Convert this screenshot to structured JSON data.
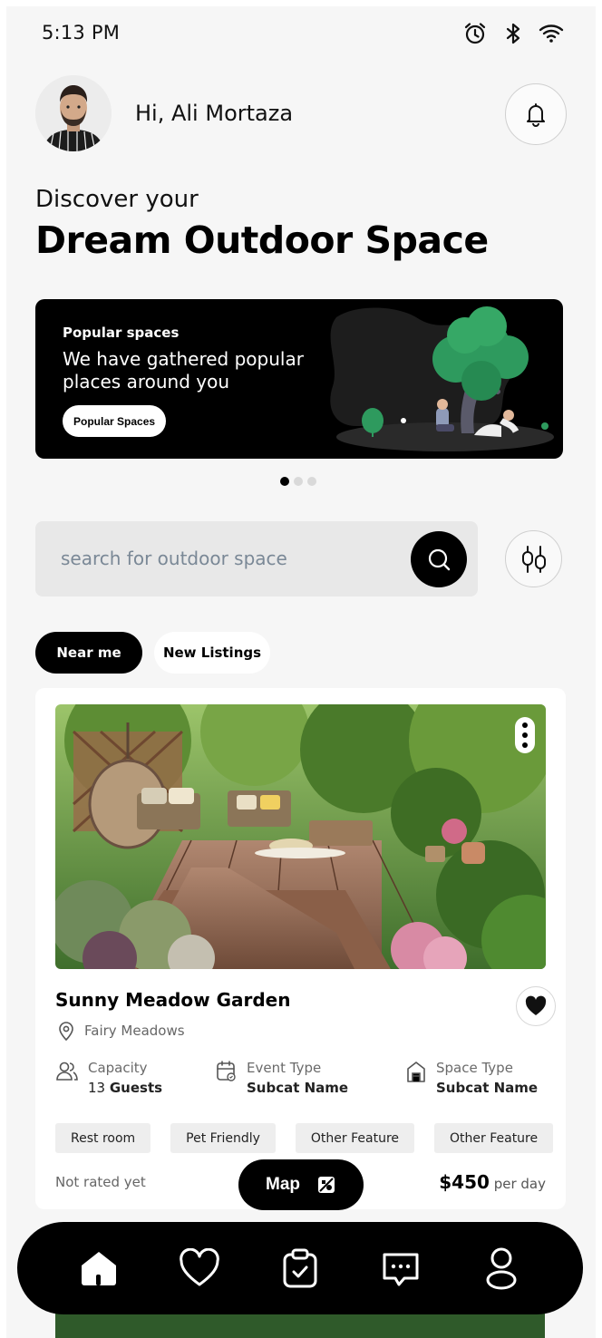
{
  "status_bar": {
    "time": "5:13 PM",
    "icons": [
      "alarm-icon",
      "bluetooth-icon",
      "wifi-icon"
    ]
  },
  "header": {
    "greeting": "Hi, Ali Mortaza",
    "avatar": "user-avatar",
    "notification_icon": "bell-icon"
  },
  "hero": {
    "subtitle": "Discover your",
    "title": "Dream Outdoor Space"
  },
  "banner": {
    "kicker": "Popular spaces",
    "text": "We have gathered popular places around you",
    "button_label": "Popular Spaces",
    "slides_total": 3,
    "active_slide": 1
  },
  "search": {
    "placeholder": "search for outdoor space",
    "search_icon": "search-icon",
    "filter_icon": "sliders-icon"
  },
  "tabs": [
    {
      "label": "Near me",
      "active": true
    },
    {
      "label": "New Listings",
      "active": false
    }
  ],
  "listing": {
    "title": "Sunny Meadow Garden",
    "location": "Fairy Meadows",
    "capacity_label": "Capacity",
    "capacity_number": "13",
    "capacity_unit": "Guests",
    "event_type_label": "Event Type",
    "event_type_value": "Subcat Name",
    "space_type_label": "Space Type",
    "space_type_value": "Subcat Name",
    "features": [
      "Rest room",
      "Pet Friendly",
      "Other Feature",
      "Other Feature"
    ],
    "rating": "Not rated yet",
    "price": "$450",
    "price_unit": "per day",
    "favorited": true
  },
  "map_button": {
    "label": "Map",
    "icon": "map-icon"
  },
  "bottom_nav": [
    {
      "name": "home",
      "icon": "home-icon",
      "active": true
    },
    {
      "name": "favorites",
      "icon": "heart-icon",
      "active": false
    },
    {
      "name": "bookings",
      "icon": "clipboard-check-icon",
      "active": false
    },
    {
      "name": "messages",
      "icon": "chat-icon",
      "active": false
    },
    {
      "name": "profile",
      "icon": "user-icon",
      "active": false
    }
  ],
  "colors": {
    "primary": "#000000",
    "background": "#f6f6f6",
    "card": "#ffffff",
    "chip_bg": "#eeeeee",
    "search_bg": "#e8e8e8",
    "accent_green": "#2e9a5e"
  }
}
